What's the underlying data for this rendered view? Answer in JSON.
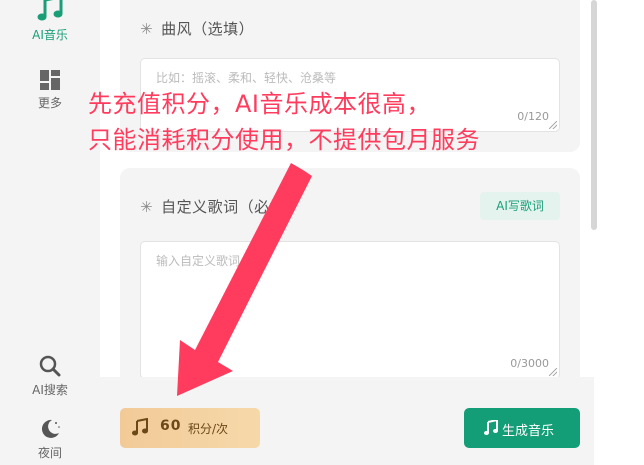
{
  "sidebar": {
    "items": [
      {
        "label": "AI音乐",
        "icon": "music-note-icon",
        "active": true
      },
      {
        "label": "更多",
        "icon": "grid-icon"
      },
      {
        "label": "AI搜索",
        "icon": "search-icon"
      },
      {
        "label": "夜间",
        "icon": "moon-icon"
      }
    ]
  },
  "style_card": {
    "star": "✳",
    "title": "曲风（选填）",
    "placeholder": "比如：摇滚、柔和、轻快、沧桑等",
    "counter": "0/120"
  },
  "lyrics_card": {
    "star": "✳",
    "title": "自定义歌词（必填）",
    "ai_button": "AI写歌词",
    "placeholder": "输入自定义歌词",
    "counter": "0/3000"
  },
  "bottom": {
    "cost_value": "60",
    "cost_unit": "积分/次",
    "generate_label": "生成音乐"
  },
  "annotation": {
    "line1": "先充值积分，AI音乐成本很高，",
    "line2": "只能消耗积分使用，不提供包月服务",
    "color": "#ff3c5e"
  },
  "colors": {
    "accent": "#139e78",
    "cost_gradient_start": "#f2ca98",
    "cost_gradient_end": "#f6d9a9"
  }
}
